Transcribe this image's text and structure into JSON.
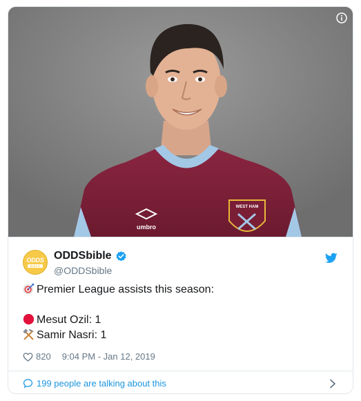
{
  "tweet": {
    "display_name": "ODDSbible",
    "handle": "@ODDSbible",
    "avatar_text_top": "ODDS",
    "avatar_text_bottom": "BIBLE",
    "line1": "Premier League assists this season:",
    "line2": "Mesut Ozil: 1",
    "line3": "Samir Nasri: 1",
    "likes": "820",
    "timestamp": "9:04 PM - Jan 12, 2019",
    "talking": "199 people are talking about this"
  },
  "media": {
    "badge_text": "WEST HAM UNITED",
    "sponsor_text": "umbro"
  },
  "icons": {
    "info": "info-icon",
    "verified": "verified-badge-icon",
    "bird": "twitter-bird-icon",
    "target": "direct-hit-emoji-icon",
    "red_circle": "red-circle-emoji-icon",
    "hammers": "hammer-and-pick-emoji-icon",
    "heart": "heart-icon",
    "speech": "speech-bubble-icon",
    "chevron": "chevron-right-icon"
  },
  "colors": {
    "twitter_blue": "#1da1f2",
    "link_blue": "#1b95e0",
    "claret": "#7a1e35",
    "avatar_yellow": "#f7c948",
    "muted": "#657786"
  }
}
